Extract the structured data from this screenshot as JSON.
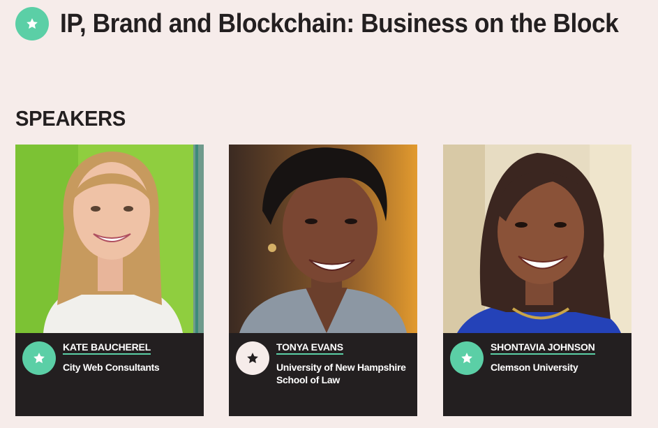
{
  "page": {
    "title": "IP, Brand and Blockchain: Business on the Block",
    "title_icon": "star-icon"
  },
  "speakers_heading": "SPEAKERS",
  "colors": {
    "accent": "#5bcfa6",
    "background": "#f6ecea",
    "card_dark": "#231f20"
  },
  "speakers": [
    {
      "name": "KATE BAUCHEREL",
      "organization": "City Web Consultants",
      "badge_icon": "star-icon",
      "badge_style": "green"
    },
    {
      "name": "TONYA EVANS",
      "organization": "University of New Hampshire School of Law",
      "badge_icon": "star-icon",
      "badge_style": "light"
    },
    {
      "name": "SHONTAVIA JOHNSON",
      "organization": "Clemson University",
      "badge_icon": "star-icon",
      "badge_style": "green"
    }
  ]
}
